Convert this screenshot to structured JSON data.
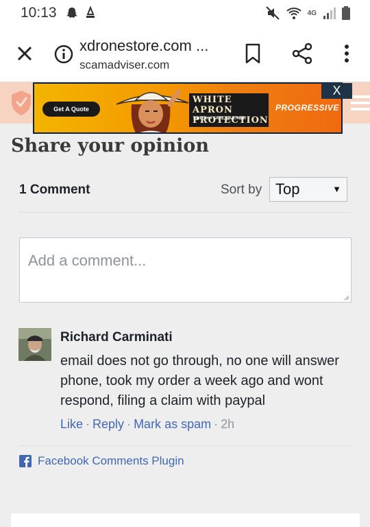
{
  "status_bar": {
    "time": "10:13",
    "network": "4G"
  },
  "browser": {
    "domain": "xdronestore.com ...",
    "subtitle": "scamadviser.com"
  },
  "ad": {
    "quote_button": "Get A Quote",
    "headline_line1": "WHITE APRON",
    "headline_line2": "PROTECTION",
    "tagline": "SWITCH • SAVE, PARTNER",
    "brand": "PROGRESSIVE",
    "close_label": "X"
  },
  "section": {
    "title": "Share your opinion"
  },
  "comments_plugin": {
    "count_label": "1 Comment",
    "sort_label": "Sort by",
    "sort_selected": "Top",
    "input_placeholder": "Add a comment...",
    "footer_label": "Facebook Comments Plugin"
  },
  "comments": [
    {
      "author": "Richard Carminati",
      "text": "email does not go through, no one will answer phone, took my order a week ago and wont respond, filing a claim with paypal",
      "actions": {
        "like": "Like",
        "reply": "Reply",
        "spam": "Mark as spam",
        "time": "2h"
      }
    }
  ],
  "colors": {
    "fb_blue": "#4267b2",
    "header_bg": "#f7d3c2",
    "ad_orange": "#f49a00",
    "page_bg": "#eeeeee"
  }
}
